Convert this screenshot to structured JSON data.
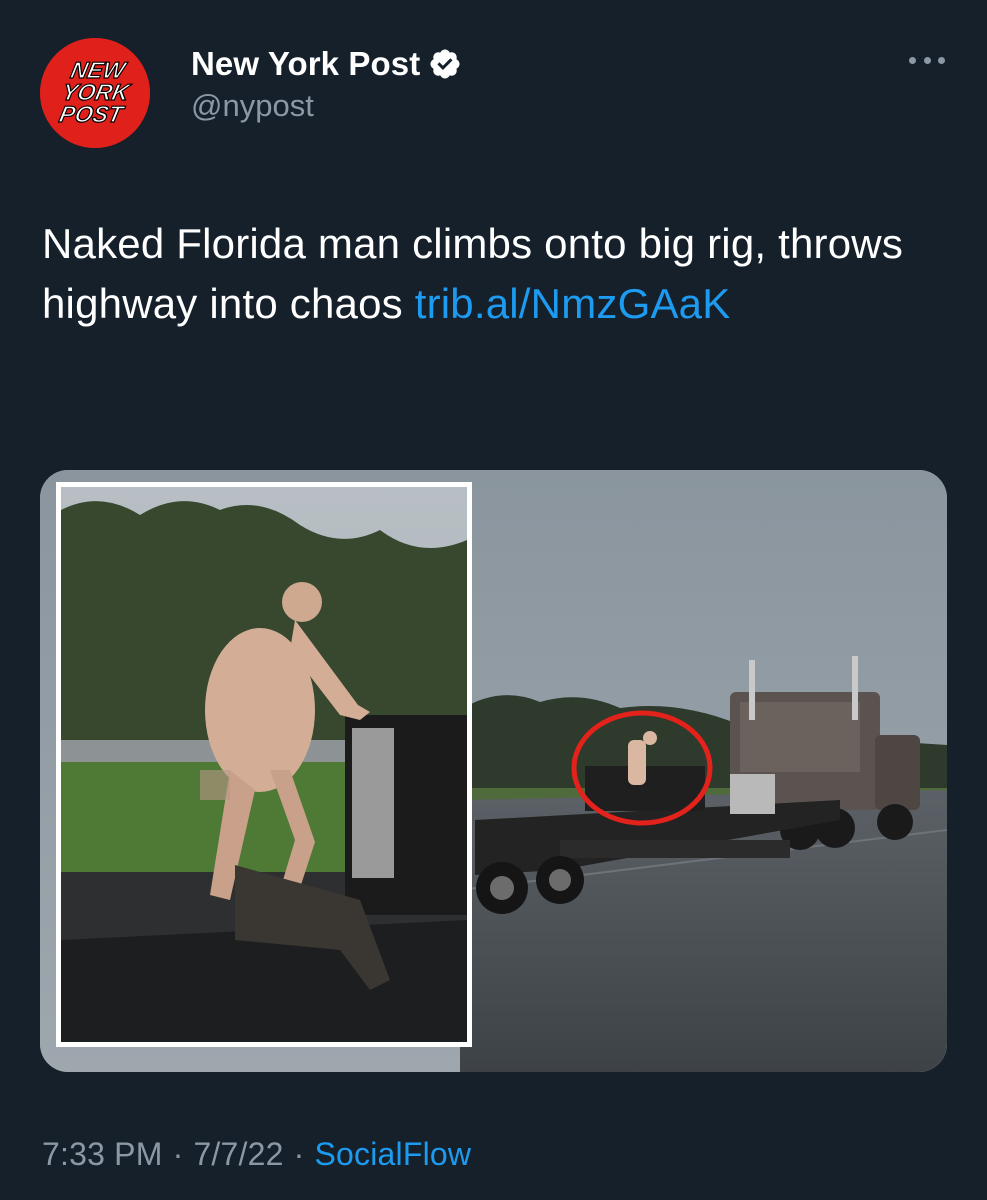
{
  "tweet": {
    "author": {
      "display_name": "New York Post",
      "handle": "@nypost",
      "verified": true,
      "avatar_logo_text": [
        "NEW",
        "YORK",
        "POST"
      ],
      "avatar_color": "#e0211b"
    },
    "text": "Naked Florida man climbs onto big rig, throws highway into chaos ",
    "link_text": "trib.al/NmzGAaK",
    "link_color": "#1d9bf0",
    "time": "7:33 PM",
    "date": "7/7/22",
    "separator": "·",
    "source": "SocialFlow"
  },
  "icons": {
    "verified": "verified-badge-icon",
    "more": "more-options-icon"
  },
  "colors": {
    "background": "#15202b",
    "secondary_text": "#8b98a5",
    "accent": "#1d9bf0"
  }
}
